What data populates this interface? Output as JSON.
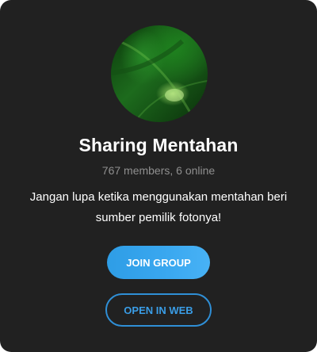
{
  "group": {
    "name": "Sharing Mentahan",
    "member_info": "767 members, 6 online",
    "description": "Jangan lupa ketika menggunakan mentahan beri sumber pemilik fotonya!"
  },
  "actions": {
    "join_label": "JOIN GROUP",
    "open_web_label": "OPEN IN WEB"
  },
  "colors": {
    "card_background": "#212121",
    "accent_blue": "#3aa8f0",
    "muted_text": "#8f8f8f"
  },
  "avatar": {
    "icon": "leaf-photo-avatar"
  }
}
